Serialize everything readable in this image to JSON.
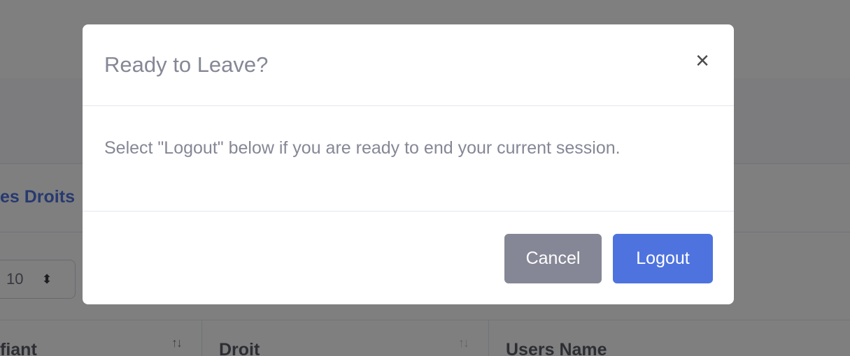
{
  "background": {
    "card_title": "es Droits",
    "length_select": {
      "value": "10",
      "caret": "⬍"
    },
    "table_headers": [
      {
        "label": "fiant",
        "sort": "↑↓"
      },
      {
        "label": "Droit",
        "sort": "↑↓"
      },
      {
        "label": "Users Name"
      }
    ]
  },
  "modal": {
    "title": "Ready to Leave?",
    "close_glyph": "×",
    "body": "Select \"Logout\" below if you are ready to end your current session.",
    "cancel_label": "Cancel",
    "logout_label": "Logout"
  },
  "colors": {
    "primary": "#4e73df",
    "secondary": "#858796",
    "backdrop": "rgba(0,0,0,0.5)"
  }
}
